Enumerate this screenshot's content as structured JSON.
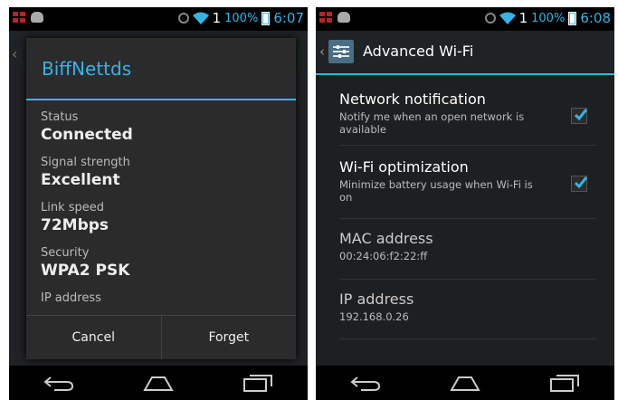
{
  "colors": {
    "accent": "#33b5e5",
    "dialog_bg": "#2b2b2c",
    "screen_bg": "#1d1f21"
  },
  "left": {
    "status": {
      "signal": "1",
      "battery": "100%",
      "time": "6:07"
    },
    "dialog": {
      "title": "BiffNettds",
      "fields": [
        {
          "label": "Status",
          "value": "Connected"
        },
        {
          "label": "Signal strength",
          "value": "Excellent"
        },
        {
          "label": "Link speed",
          "value": "72Mbps"
        },
        {
          "label": "Security",
          "value": "WPA2 PSK"
        },
        {
          "label": "IP address",
          "value": ""
        }
      ],
      "cancel_label": "Cancel",
      "forget_label": "Forget"
    }
  },
  "right": {
    "status": {
      "signal": "1",
      "battery": "100%",
      "time": "6:08"
    },
    "action_bar": {
      "title": "Advanced Wi-Fi",
      "icon": "settings-app-icon"
    },
    "prefs": [
      {
        "title": "Network notification",
        "summary": "Notify me when an open network is available",
        "checked": true
      },
      {
        "title": "Wi-Fi optimization",
        "summary": "Minimize battery usage when Wi-Fi is on",
        "checked": true
      },
      {
        "title": "MAC address",
        "summary": "00:24:06:f2:22:ff"
      },
      {
        "title": "IP address",
        "summary": "192.168.0.26"
      }
    ]
  },
  "navbar": {
    "back_icon": "back-icon",
    "home_icon": "home-icon",
    "recents_icon": "recents-icon"
  }
}
